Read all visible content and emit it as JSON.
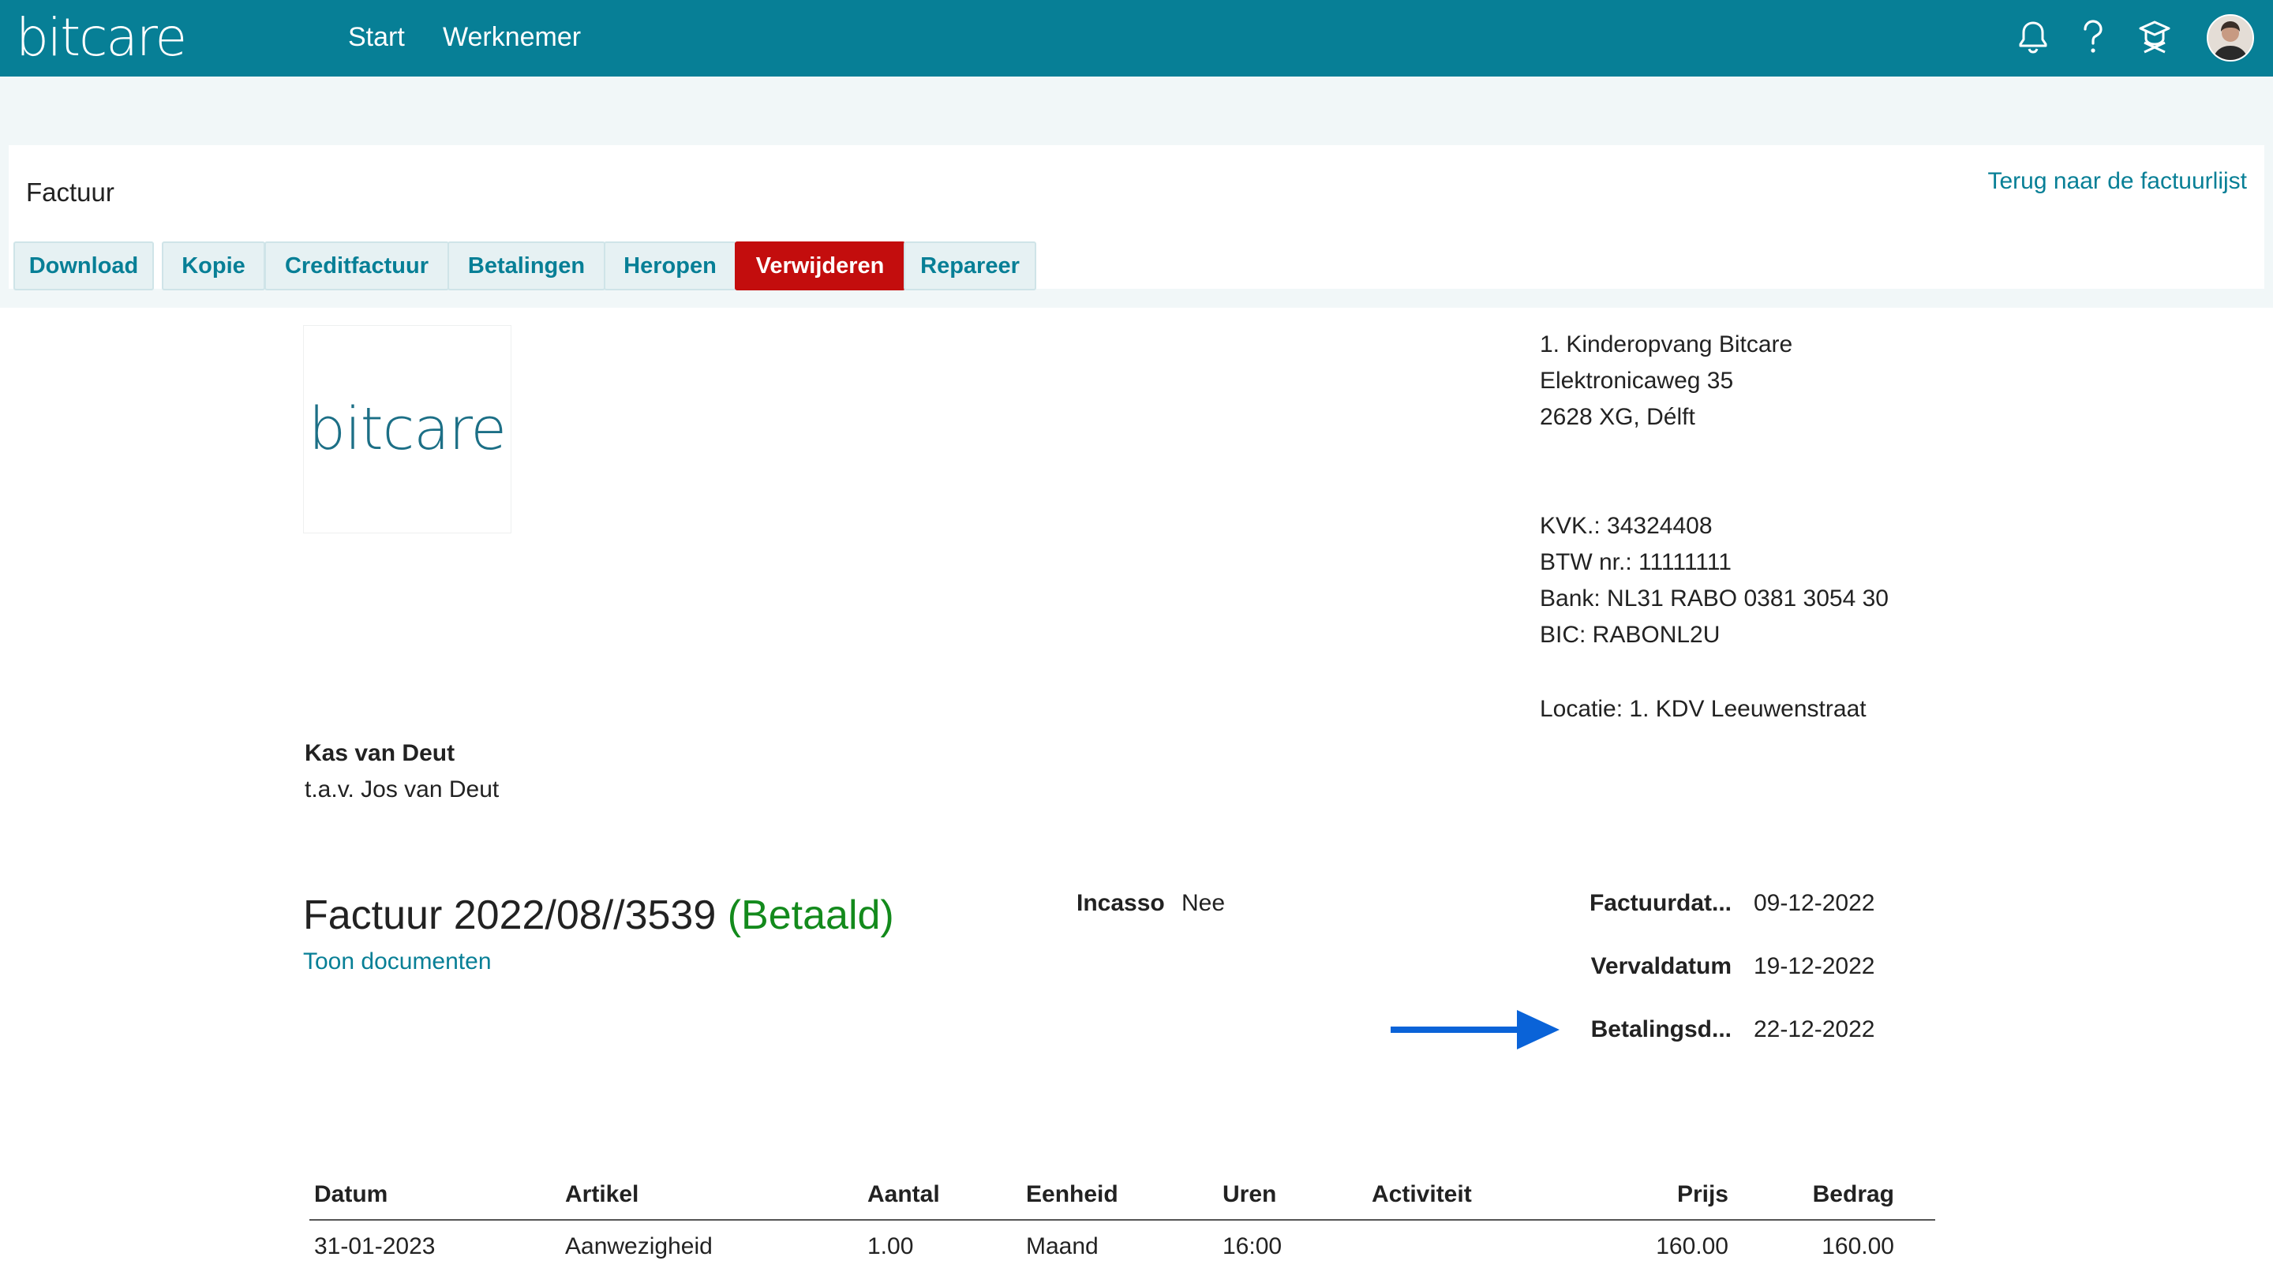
{
  "app": {
    "brand": "bitcare",
    "nav": {
      "start": "Start",
      "werknemer": "Werknemer"
    },
    "icons": [
      "bell-icon",
      "help-icon",
      "graduation-cap-icon",
      "user-avatar"
    ],
    "accent_color": "#077f96"
  },
  "header": {
    "title": "Factuur",
    "back_link": "Terug naar de factuurlijst",
    "tabs": {
      "download": "Download",
      "kopie": "Kopie",
      "creditfactuur": "Creditfactuur",
      "betalingen": "Betalingen",
      "heropen": "Heropen",
      "verwijderen": "Verwijderen",
      "repareer": "Repareer"
    }
  },
  "company": {
    "logo_text": "bitcare",
    "name": "1. Kinderopvang Bitcare",
    "street": "Elektronicaweg 35",
    "city": "2628 XG, Délft",
    "kvk": "KVK.: 34324408",
    "btw": "BTW nr.: 11111111",
    "bank": "Bank: NL31 RABO 0381 3054 30",
    "bic": "BIC: RABONL2U",
    "location": "Locatie: 1. KDV Leeuwenstraat"
  },
  "recipient": {
    "name": "Kas van Deut",
    "attention": "t.a.v. Jos van Deut"
  },
  "invoice": {
    "title": "Factuur 2022/08//3539",
    "status": "(Betaald)",
    "documents_link": "Toon documenten",
    "incasso_label": "Incasso",
    "incasso_value": "Nee",
    "factuurdatum_label": "Factuurdat...",
    "factuurdatum_value": "09-12-2022",
    "vervaldatum_label": "Vervaldatum",
    "vervaldatum_value": "19-12-2022",
    "betalingsdatum_label": "Betalingsd...",
    "betalingsdatum_value": "22-12-2022"
  },
  "table": {
    "headers": {
      "datum": "Datum",
      "artikel": "Artikel",
      "aantal": "Aantal",
      "eenheid": "Eenheid",
      "uren": "Uren",
      "activiteit": "Activiteit",
      "prijs": "Prijs",
      "bedrag": "Bedrag"
    },
    "rows": [
      {
        "datum": "31-01-2023",
        "artikel": "Aanwezigheid",
        "aantal": "1.00",
        "eenheid": "Maand",
        "uren": "16:00",
        "activiteit": "",
        "prijs": "160.00",
        "bedrag": "160.00"
      }
    ]
  }
}
